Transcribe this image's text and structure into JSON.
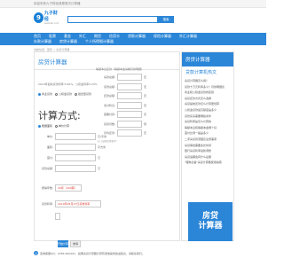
{
  "topbar": {
    "text": "欢迎来到九子财经我是首次计算器"
  },
  "logo": {
    "mark": "9",
    "name": "九子财经",
    "domain": "www.9zi.com"
  },
  "search": {
    "placeholder": "",
    "button": "搜索"
  },
  "nav": {
    "row1": [
      "首页",
      "股票",
      "基金",
      "外汇",
      "期货",
      "信用卡",
      "贷款计算器",
      "保险计算器",
      "外汇计算器"
    ],
    "row2": [
      "存款计算器",
      "房贷计算器",
      "个人所得税计算器"
    ]
  },
  "breadcrumb": "当前位置：首页 > 房贷计算器",
  "calculator": {
    "title": "房贷计算器",
    "intro": "2019年最新贷款利率:5.90%，公积金利率3.25%",
    "modes": [
      "商业贷款",
      "公积金贷款",
      "组合型贷款"
    ],
    "big_title": "计算方式:",
    "sub_modes": [
      "根据面积",
      "单价计算"
    ],
    "fields": [
      {
        "label": "单价:",
        "unit": "元/平米"
      },
      {
        "label": "面积:",
        "unit": "平方米"
      },
      {
        "label": "首付:",
        "unit": "元"
      },
      {
        "label": "贷款总额:",
        "unit": "元"
      }
    ],
    "years_label": "按揭年数:",
    "years_value": "20年（240期）",
    "rate_label": "贷款利率:",
    "rate_value": "2019年05月17日基准利率",
    "rate_input": "",
    "calc_button": "开始计算",
    "reset_button": "重填"
  },
  "results": {
    "head": "等额本息还款（等额本金请看月供明细）",
    "rows": [
      {
        "label": "房款总额:",
        "unit": "元"
      },
      {
        "label": "贷款总额:",
        "unit": "元"
      },
      {
        "label": "还款总额:",
        "unit": "元"
      },
      {
        "label": "支付利息:",
        "unit": "元"
      },
      {
        "label": "首期付款:",
        "unit": "元"
      },
      {
        "label": "贷款月数:",
        "unit": "月"
      },
      {
        "label": "月均还款:",
        "unit": "元"
      }
    ],
    "note": "（以上结果仅供参考）"
  },
  "sidebar": {
    "head": "房贷计算器",
    "block_title": "贷款计算机热文",
    "items": [
      "房贷计算器怎么用？",
      "贷款十万元利率多少？月供明细表",
      "商业和公积金贷款的区别",
      "房贷还款方式怎么选择",
      "房贷提前还款怎么计算更划算",
      "公积金贷款最高额度是多少",
      "贷款买房需要哪些条件",
      "房贷利率是怎么计算的",
      "等额本息和等额本金哪个好",
      "首付比例一般是多少",
      "二手房贷款流程及注意事项",
      "房贷审批需要多长时间",
      "银行房贷利率最新调整",
      "房贷逾期会有什么后果",
      "\"理财必备\"房贷计算器使用指南"
    ],
    "promo": [
      "房贷",
      "计算器"
    ]
  },
  "footer": {
    "icon": "九",
    "text": "咨询客服QQ：2786-000401，如果房贷计算器计算有误或提供改进建议，请联系我们。"
  },
  "colors": {
    "brand": "#2b86d8",
    "accent": "#e0433a"
  }
}
